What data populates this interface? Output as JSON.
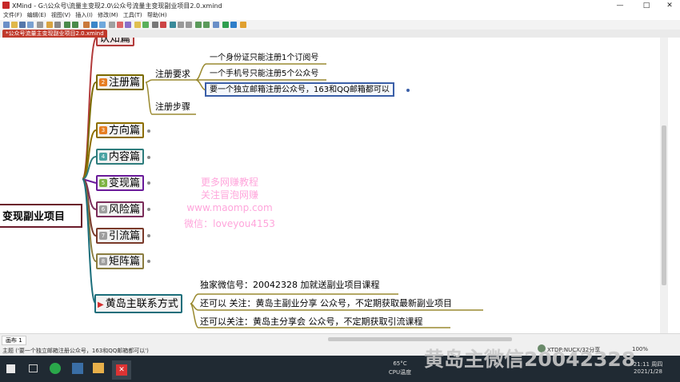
{
  "window": {
    "title": "XMind - G:\\公众号\\流量主变现2.0\\公众号流量主变现副业项目2.0.xmind",
    "minimize": "—",
    "maximize": "□",
    "close": "✕"
  },
  "menu": [
    "文件(F)",
    "编辑(E)",
    "视图(V)",
    "插入(I)",
    "修改(M)",
    "工具(T)",
    "帮助(H)"
  ],
  "doc_tab": "*公众号流量主变现副业项目2.0.xmind",
  "mindmap": {
    "root": "变现副业项目",
    "top_partial": "认知篇",
    "sections": [
      {
        "num": "2",
        "label": "注册篇",
        "color": "#7a6a00"
      },
      {
        "num": "3",
        "label": "方向篇",
        "color": "#8d6e00"
      },
      {
        "num": "4",
        "label": "内容篇",
        "color": "#2e7d7d"
      },
      {
        "num": "5",
        "label": "变现篇",
        "color": "#6a1b9a"
      },
      {
        "num": "6",
        "label": "风险篇",
        "color": "#7b2d5a"
      },
      {
        "num": "7",
        "label": "引流篇",
        "color": "#7a3a2a"
      },
      {
        "num": "8",
        "label": "矩阵篇",
        "color": "#8b7d40"
      },
      {
        "num": "",
        "label": "黄岛主联系方式",
        "color": "#1b6e7b"
      }
    ],
    "register_requirements": "注册要求",
    "register_steps": "注册步骤",
    "requirements": [
      "一个身份证只能注册1个订阅号",
      "一个手机号只能注册5个公众号",
      "要一个独立邮箱注册公众号，163和QQ邮箱都可以"
    ],
    "contacts": [
      "独家微信号：20042328 加就送副业项目课程",
      "还可以 关注：黄岛主副业分享 公众号，不定期获取最新副业项目",
      "还可以关注：黄岛主分享会 公众号，不定期获取引流课程"
    ]
  },
  "watermark": [
    "更多网赚教程",
    "关注冒泡网赚",
    "www.maomp.com",
    "微信：loveyou4153"
  ],
  "bottom": {
    "sheet_tab": "画布 1",
    "status": "主题 ('要一个独立邮箱注册公众号，163和QQ邮箱都可以')",
    "user": "XTDP:NUCX/32分享",
    "zoom": "100%"
  },
  "taskbar": {
    "weather_temp": "65°C",
    "weather_label": "CPU温度",
    "time": "21:11 周四",
    "date": "2021/1/28"
  },
  "overlay_text": "黄岛主微信20042328",
  "colors": {
    "accent": "#c0392b",
    "selected_border": "#3b5fa8"
  }
}
